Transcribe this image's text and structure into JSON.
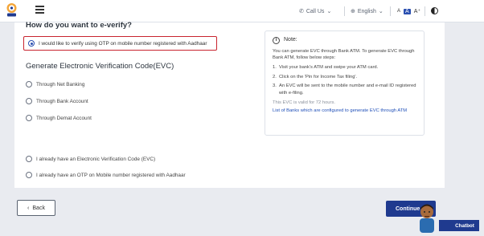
{
  "topbar": {
    "call_us": "Call Us",
    "language": "English",
    "font_small": "A",
    "font_normal": "A",
    "font_large": "A⁺"
  },
  "main": {
    "question": "How do you want to e-verify?",
    "otp_option": "I would like to verify using OTP on mobile number registered with Aadhaar",
    "evc_heading": "Generate Electronic Verification Code(EVC)",
    "evc_options": [
      "Through Net Banking",
      "Through Bank Account",
      "Through Demat Account"
    ],
    "other_options": [
      "I already have an Electronic Verification Code (EVC)",
      "I already have an OTP on Mobile number registered with Aadhaar"
    ]
  },
  "note": {
    "title": "Note:",
    "intro": "You can generate EVC through Bank ATM. To generate EVC through Bank ATM, follow below steps:",
    "steps": [
      "Visit your bank's ATM and swipe your ATM card.",
      "Click on the 'Pin for Income Tax filing'.",
      "An EVC will be sent to the mobile number and e-mail ID registered with e-filing."
    ],
    "validity": "This EVC is valid for 72 hours.",
    "link": "List of Banks which are configured to generate EVC through ATM"
  },
  "footer": {
    "back": "Back",
    "continue": "Continue",
    "chatbot": "Chatbot"
  },
  "colors": {
    "primary": "#1f3a8f",
    "highlight_border": "#c8242f",
    "link": "#1f4fb8"
  }
}
